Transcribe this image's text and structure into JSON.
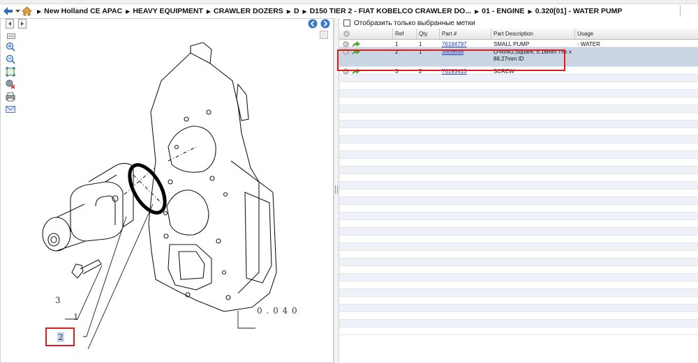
{
  "breadcrumb": {
    "items": [
      "New Holland CE APAC",
      "HEAVY EQUIPMENT",
      "CRAWLER DOZERS",
      "D",
      "D150 TIER 2 - FIAT KOBELCO CRAWLER DO...",
      "01 - ENGINE",
      "0.320[01] - WATER PUMP"
    ]
  },
  "drawing": {
    "callouts": {
      "c3": "3",
      "c1": "1",
      "c2": "2",
      "ref": "0 . 0 4 0"
    }
  },
  "filter": {
    "label": "Отобразить только выбранные метки",
    "checked": false
  },
  "table": {
    "headers": {
      "ref": "Ref",
      "qty": "Qty",
      "part": "Part #",
      "desc": "Part Description",
      "usage": "Usage"
    },
    "rows": [
      {
        "ref": "1",
        "qty": "1",
        "part": "76194797",
        "desc": "SMALL PUMP",
        "usage": "- WATER"
      },
      {
        "ref": "2",
        "qty": "1",
        "part": "3906698",
        "desc": "O-RING,Square, 5.16mm Thk x 88.27mm ID",
        "usage": ""
      },
      {
        "ref": "3",
        "qty": "2",
        "part": "76193413",
        "desc": "SCREW",
        "usage": ""
      }
    ],
    "selected_row": 2
  },
  "colors": {
    "highlight_border": "#e01b1b",
    "selected_row": "#c9d5e3",
    "link": "#1a35c9",
    "nav_button": "#3a78c8"
  },
  "icons": {
    "back": "back-arrow-icon",
    "home": "home-icon",
    "prev": "prev-page-icon",
    "next": "next-page-icon",
    "zoom_in": "zoom-in-icon",
    "zoom_out": "zoom-out-icon",
    "fit": "fit-to-window-icon",
    "clear": "clear-selection-icon",
    "print": "print-icon",
    "email": "email-icon",
    "add": "plus-circle-icon",
    "go": "go-to-arrow-icon"
  }
}
